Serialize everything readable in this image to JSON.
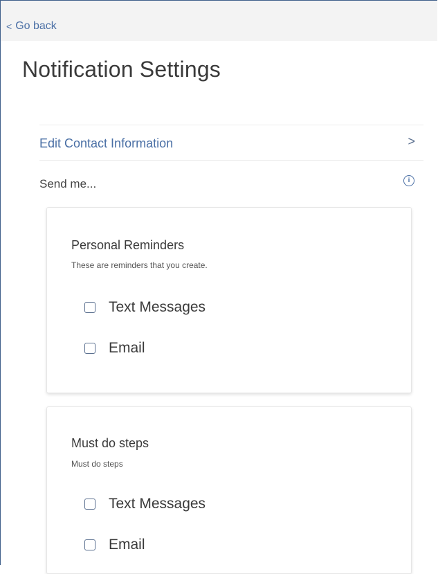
{
  "nav": {
    "back_chevron": "<",
    "back_label": "Go back"
  },
  "page": {
    "title": "Notification Settings"
  },
  "contact": {
    "edit_label": "Edit Contact Information",
    "chevron": ">"
  },
  "send": {
    "label": "Send me...",
    "info_icon": "i"
  },
  "cards": [
    {
      "title": "Personal Reminders",
      "description": "These are reminders that you create.",
      "options": [
        {
          "label": "Text Messages",
          "checked": false
        },
        {
          "label": "Email",
          "checked": false
        }
      ]
    },
    {
      "title": "Must do steps",
      "description": "Must do steps",
      "options": [
        {
          "label": "Text Messages",
          "checked": false
        },
        {
          "label": "Email",
          "checked": false
        }
      ]
    }
  ],
  "colors": {
    "link": "#4a6fa5",
    "text": "#3a3a3a",
    "topbar": "#f3f3f3"
  }
}
